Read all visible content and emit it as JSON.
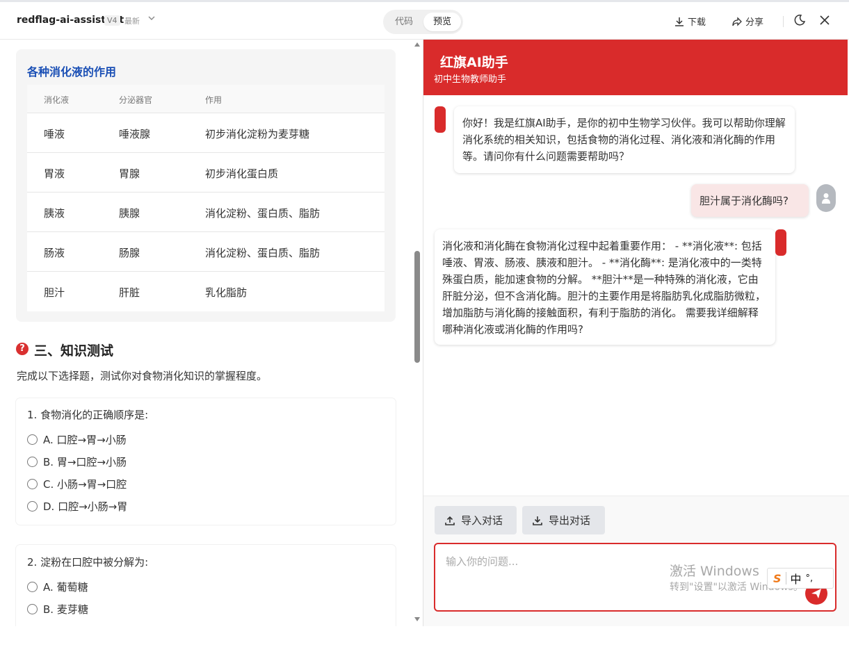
{
  "topbar": {
    "app_name": "redflag-ai-assistant",
    "version": "V4",
    "latest": "最新",
    "tab_code": "代码",
    "tab_preview": "预览",
    "download": "下载",
    "share": "分享"
  },
  "digest_table": {
    "title": "各种消化液的作用",
    "headers": [
      "消化液",
      "分泌器官",
      "作用"
    ],
    "rows": [
      [
        "唾液",
        "唾液腺",
        "初步消化淀粉为麦芽糖"
      ],
      [
        "胃液",
        "胃腺",
        "初步消化蛋白质"
      ],
      [
        "胰液",
        "胰腺",
        "消化淀粉、蛋白质、脂肪"
      ],
      [
        "肠液",
        "肠腺",
        "消化淀粉、蛋白质、脂肪"
      ],
      [
        "胆汁",
        "肝脏",
        "乳化脂肪"
      ]
    ]
  },
  "quiz": {
    "section_icon": "?",
    "section_title": "三、知识测试",
    "description": "完成以下选择题，测试你对食物消化知识的掌握程度。",
    "q1": {
      "text": "1. 食物消化的正确顺序是:",
      "options": [
        "A. 口腔→胃→小肠",
        "B. 胃→口腔→小肠",
        "C. 小肠→胃→口腔",
        "D. 口腔→小肠→胃"
      ]
    },
    "q2": {
      "text": "2. 淀粉在口腔中被分解为:",
      "options": [
        "A. 葡萄糖",
        "B. 麦芽糖"
      ]
    }
  },
  "chat": {
    "title": "红旗AI助手",
    "subtitle": "初中生物教师助手",
    "ai_message_1": "你好！我是红旗AI助手，是你的初中生物学习伙伴。我可以帮助你理解消化系统的相关知识，包括食物的消化过程、消化液和消化酶的作用等。请问你有什么问题需要帮助吗？",
    "user_message_1": "胆汁属于消化酶吗?",
    "ai_message_2": "消化液和消化酶在食物消化过程中起着重要作用： - **消化液**: 包括唾液、胃液、肠液、胰液和胆汁。 - **消化酶**: 是消化液中的一类特殊蛋白质，能加速食物的分解。 **胆汁**是一种特殊的消化液，它由肝脏分泌，但不含消化酶。胆汁的主要作用是将脂肪乳化成脂肪微粒，增加脂肪与消化酶的接触面积，有利于脂肪的消化。 需要我详细解释哪种消化液或消化酶的作用吗?",
    "import_label": "导入对话",
    "export_label": "导出对话",
    "input_placeholder": "输入你的问题..."
  },
  "overlay": {
    "watermark_line1": "激活 Windows",
    "watermark_line2": "转到\"设置\"以激活 Windows。",
    "ime_lang": "中",
    "ime_punct": "°,"
  },
  "colors": {
    "brand_red": "#d92b2b",
    "title_blue": "#1a4fb5"
  }
}
